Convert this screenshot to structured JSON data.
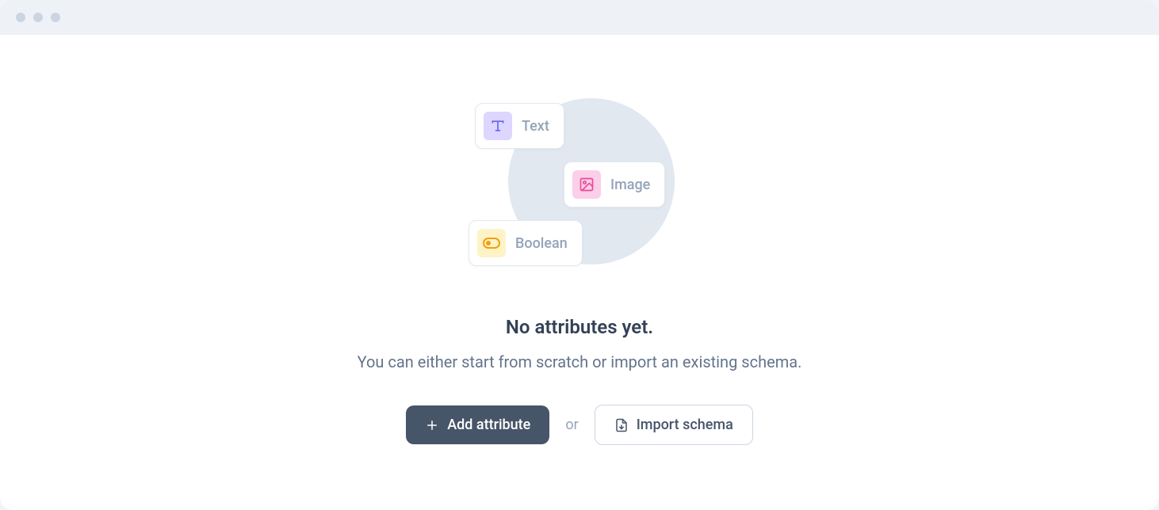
{
  "chips": [
    {
      "label": "Text"
    },
    {
      "label": "Image"
    },
    {
      "label": "Boolean"
    }
  ],
  "empty_state": {
    "title": "No attributes yet.",
    "subtitle": "You can either start from scratch or import an existing schema."
  },
  "actions": {
    "add_label": "Add attribute",
    "or": "or",
    "import_label": "Import schema"
  }
}
